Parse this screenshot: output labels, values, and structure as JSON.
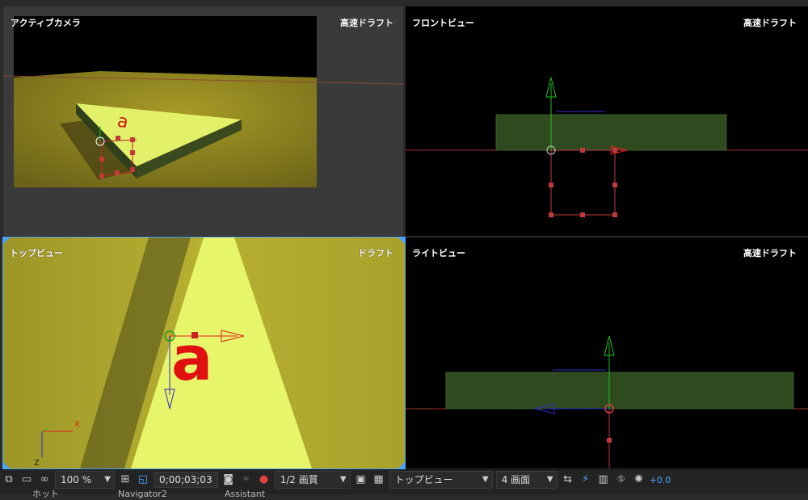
{
  "viewports": {
    "active_camera": {
      "title": "アクティブカメラ",
      "quality": "高速ドラフト"
    },
    "front_view": {
      "title": "フロントビュー",
      "quality": "高速ドラフト"
    },
    "top_view": {
      "title": "トップビュー",
      "quality": "ドラフト",
      "axes": {
        "x": "X",
        "z": "Z"
      },
      "layer_text": "a"
    },
    "right_view": {
      "title": "ライトビュー",
      "quality": "高速ドラフト"
    }
  },
  "toolbar": {
    "zoom": "100 %",
    "timecode": "0;00;03;03",
    "resolution": "1/2 画質",
    "view": "トップビュー",
    "layout": "4 画面",
    "exposure": "+0.0"
  },
  "bottom_tabs": [
    "ホット",
    "Navigator2",
    "Assistant"
  ],
  "colors": {
    "accent": "#4aa3ff",
    "floor": "#c8c03a",
    "plane": "#e8f56a",
    "red_axis": "#e02020",
    "green_axis": "#22c022",
    "blue_axis": "#2222d0"
  }
}
